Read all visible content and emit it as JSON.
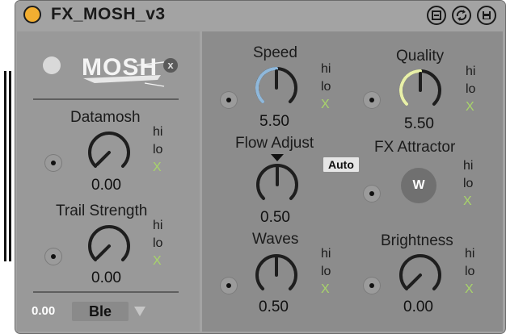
{
  "device": {
    "title": "FX_MOSH_v3",
    "accent": "#f2ae31"
  },
  "toolbar": {
    "icons": [
      "pin-icon",
      "hotswap-icon",
      "save-icon"
    ]
  },
  "logo": {
    "text": "MOSH"
  },
  "left": {
    "datamosh": {
      "label": "Datamosh",
      "value": "0.00",
      "hi": "hi",
      "lo": "lo",
      "x": "X"
    },
    "trail": {
      "label": "Trail Strength",
      "value": "0.00",
      "hi": "hi",
      "lo": "lo",
      "x": "X"
    },
    "footer": {
      "value": "0.00",
      "mode": "Ble"
    }
  },
  "right": {
    "speed": {
      "label": "Speed",
      "value": "5.50",
      "hi": "hi",
      "lo": "lo",
      "x": "X",
      "level": 0.5,
      "color": "#8fb8db"
    },
    "quality": {
      "label": "Quality",
      "value": "5.50",
      "hi": "hi",
      "lo": "lo",
      "x": "X",
      "level": 0.5,
      "color": "#e8f0a8"
    },
    "flow": {
      "label": "Flow Adjust",
      "value": "0.50",
      "auto": "Auto",
      "level": 0.5
    },
    "attractor": {
      "label": "FX Attractor",
      "button": "W",
      "hi": "hi",
      "lo": "lo",
      "x": "X"
    },
    "waves": {
      "label": "Waves",
      "value": "0.50",
      "hi": "hi",
      "lo": "lo",
      "x": "X",
      "level": 0.5
    },
    "brightness": {
      "label": "Brightness",
      "value": "0.00",
      "hi": "hi",
      "lo": "lo",
      "x": "X",
      "level": 0.0
    }
  }
}
